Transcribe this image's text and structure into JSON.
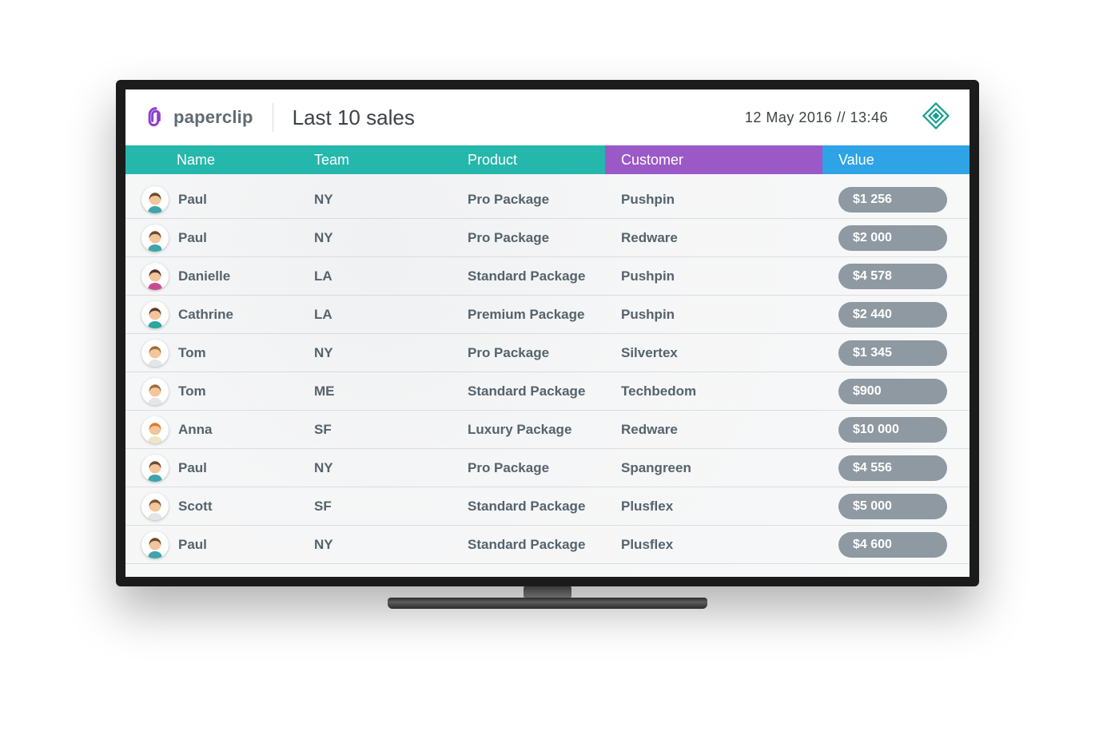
{
  "brand": {
    "name": "paperclip"
  },
  "title": "Last 10 sales",
  "datetime": "12  May 2016   //   13:46",
  "columns": {
    "name": "Name",
    "team": "Team",
    "product": "Product",
    "customer": "Customer",
    "value": "Value"
  },
  "colors": {
    "teal": "#25b7ab",
    "purple": "#9b59c7",
    "blue": "#2ea3e6",
    "pill": "#8e99a2"
  },
  "avatar_palette": {
    "Paul": {
      "hair": "#6b4a2e",
      "shirt": "#3fa4ac",
      "skin": "#f2c59a"
    },
    "Danielle": {
      "hair": "#52322a",
      "shirt": "#c94b8f",
      "skin": "#f2c59a"
    },
    "Cathrine": {
      "hair": "#5a3a2f",
      "shirt": "#2aa7a0",
      "skin": "#f2c59a"
    },
    "Tom": {
      "hair": "#a46b3a",
      "shirt": "#e2e6e9",
      "skin": "#f2c59a"
    },
    "Anna": {
      "hair": "#e1762e",
      "shirt": "#efe4c4",
      "skin": "#f2c59a"
    },
    "Scott": {
      "hair": "#7a5436",
      "shirt": "#e2e6e9",
      "skin": "#f2c59a"
    }
  },
  "rows": [
    {
      "name": "Paul",
      "team": "NY",
      "product": "Pro Package",
      "customer": "Pushpin",
      "value": "$1 256"
    },
    {
      "name": "Paul",
      "team": "NY",
      "product": "Pro Package",
      "customer": "Redware",
      "value": "$2 000"
    },
    {
      "name": "Danielle",
      "team": "LA",
      "product": "Standard Package",
      "customer": "Pushpin",
      "value": "$4 578"
    },
    {
      "name": "Cathrine",
      "team": "LA",
      "product": "Premium Package",
      "customer": "Pushpin",
      "value": "$2 440"
    },
    {
      "name": "Tom",
      "team": "NY",
      "product": "Pro Package",
      "customer": "Silvertex",
      "value": "$1 345"
    },
    {
      "name": "Tom",
      "team": "ME",
      "product": "Standard Package",
      "customer": "Techbedom",
      "value": "$900"
    },
    {
      "name": "Anna",
      "team": "SF",
      "product": "Luxury Package",
      "customer": "Redware",
      "value": "$10 000"
    },
    {
      "name": "Paul",
      "team": "NY",
      "product": "Pro Package",
      "customer": "Spangreen",
      "value": "$4 556"
    },
    {
      "name": "Scott",
      "team": "SF",
      "product": "Standard Package",
      "customer": "Plusflex",
      "value": "$5 000"
    },
    {
      "name": "Paul",
      "team": "NY",
      "product": "Standard Package",
      "customer": "Plusflex",
      "value": "$4 600"
    }
  ]
}
